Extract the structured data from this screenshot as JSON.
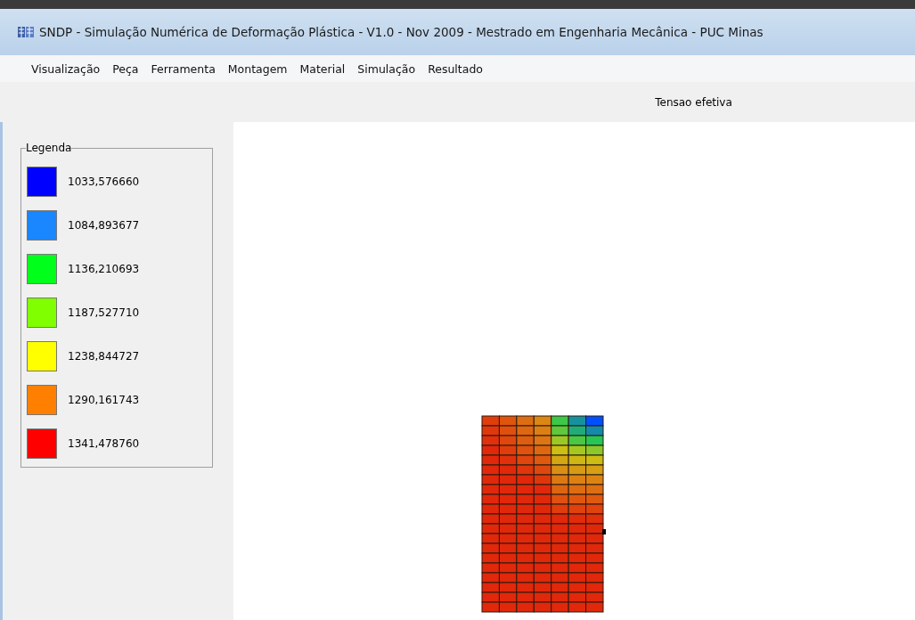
{
  "window": {
    "title": "SNDP - Simulação Numérica de Deformação Plástica - V1.0 - Nov 2009 - Mestrado em Engenharia Mecânica - PUC Minas"
  },
  "menu": [
    "Visualização",
    "Peça",
    "Ferramenta",
    "Montagem",
    "Material",
    "Simulação",
    "Resultado"
  ],
  "plot_title": "Tensao efetiva",
  "legend": {
    "title": "Legenda",
    "items": [
      {
        "value": "1033,576660",
        "color": "#0000ff"
      },
      {
        "value": "1084,893677",
        "color": "#1a86ff"
      },
      {
        "value": "1136,210693",
        "color": "#00ff1a"
      },
      {
        "value": "1187,527710",
        "color": "#80ff00"
      },
      {
        "value": "1238,844727",
        "color": "#ffff00"
      },
      {
        "value": "1290,161743",
        "color": "#ff8000"
      },
      {
        "value": "1341,478760",
        "color": "#ff0000"
      }
    ]
  }
}
